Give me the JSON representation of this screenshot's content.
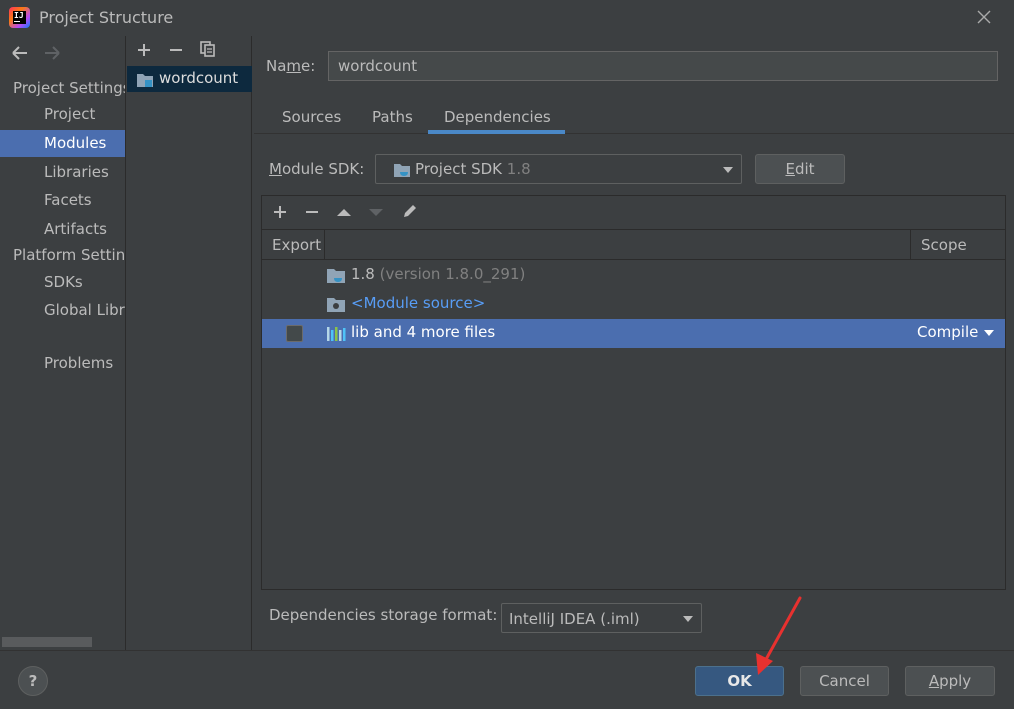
{
  "window": {
    "title": "Project Structure"
  },
  "nav": {
    "back_icon": "arrow-left-icon",
    "forward_icon": "arrow-right-icon",
    "project_settings_header": "Project Settings",
    "project_items": [
      "Project",
      "Modules",
      "Libraries",
      "Facets",
      "Artifacts"
    ],
    "platform_settings_header": "Platform Settings",
    "platform_items": [
      "SDKs",
      "Global Libraries"
    ],
    "problems": "Problems",
    "selected": "Modules"
  },
  "modules": {
    "toolbar": [
      "add-icon",
      "remove-icon",
      "copy-icon"
    ],
    "items": [
      {
        "label": "wordcount",
        "icon": "module-folder-icon"
      }
    ]
  },
  "module_detail": {
    "name_label_prefix": "Na",
    "name_label_mnemonic": "m",
    "name_label_suffix": "e:",
    "name_value": "wordcount",
    "tabs": [
      "Sources",
      "Paths",
      "Dependencies"
    ],
    "active_tab": "Dependencies",
    "sdk_label_mnemonic": "M",
    "sdk_label_rest": "odule SDK:",
    "sdk_value": "Project SDK",
    "sdk_version": "1.8",
    "edit_button_mnemonic": "E",
    "edit_button_rest": "dit"
  },
  "dependencies": {
    "toolbar": [
      "add-icon",
      "remove-icon",
      "move-up-icon",
      "move-down-icon",
      "edit-icon"
    ],
    "columns": {
      "export": "Export",
      "scope": "Scope"
    },
    "rows": [
      {
        "name": "1.8",
        "detail": "(version 1.8.0_291)",
        "icon": "jdk-folder-icon",
        "scope": "",
        "exported": false,
        "selected": false
      },
      {
        "name": "<Module source>",
        "detail": "",
        "icon": "module-source-icon",
        "scope": "",
        "exported": false,
        "selected": false
      },
      {
        "name": "lib and 4 more files",
        "detail": "",
        "icon": "library-icon",
        "scope": "Compile",
        "exported": false,
        "selected": true
      }
    ]
  },
  "storage_format": {
    "label": "Dependencies storage format:",
    "value": "IntelliJ IDEA (.iml)"
  },
  "buttons": {
    "help": "?",
    "ok": "OK",
    "cancel": "Cancel",
    "apply_mnemonic": "A",
    "apply_rest": "pply"
  },
  "colors": {
    "background": "#3c3f41",
    "selection": "#4b6eaf",
    "accent_tab": "#4a88c7",
    "ok_button": "#365880",
    "link": "#589df6",
    "annotation_arrow": "#e8312f"
  }
}
